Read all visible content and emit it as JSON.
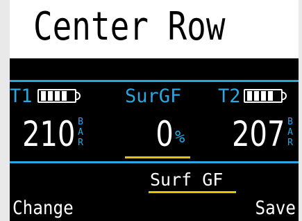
{
  "header": {
    "title": "Center Row",
    "background": "#ffffff",
    "text_color": "#000000"
  },
  "colors": {
    "accent": "#29a8e0",
    "highlight": "#e8c400",
    "text": "#ffffff",
    "screen_bg": "#000000"
  },
  "tank1": {
    "label": "T1",
    "pressure": "210",
    "unit": "BAR",
    "battery_icon": "battery-icon",
    "battery_level": 0.8
  },
  "surgf": {
    "label": "SurGF",
    "value": "0",
    "unit": "%"
  },
  "tank2": {
    "label": "T2",
    "pressure": "207",
    "unit": "BAR",
    "battery_icon": "battery-icon",
    "battery_level": 0.8
  },
  "setting": {
    "label": "Surf GF"
  },
  "softkeys": {
    "left": "Change",
    "right": "Save"
  }
}
